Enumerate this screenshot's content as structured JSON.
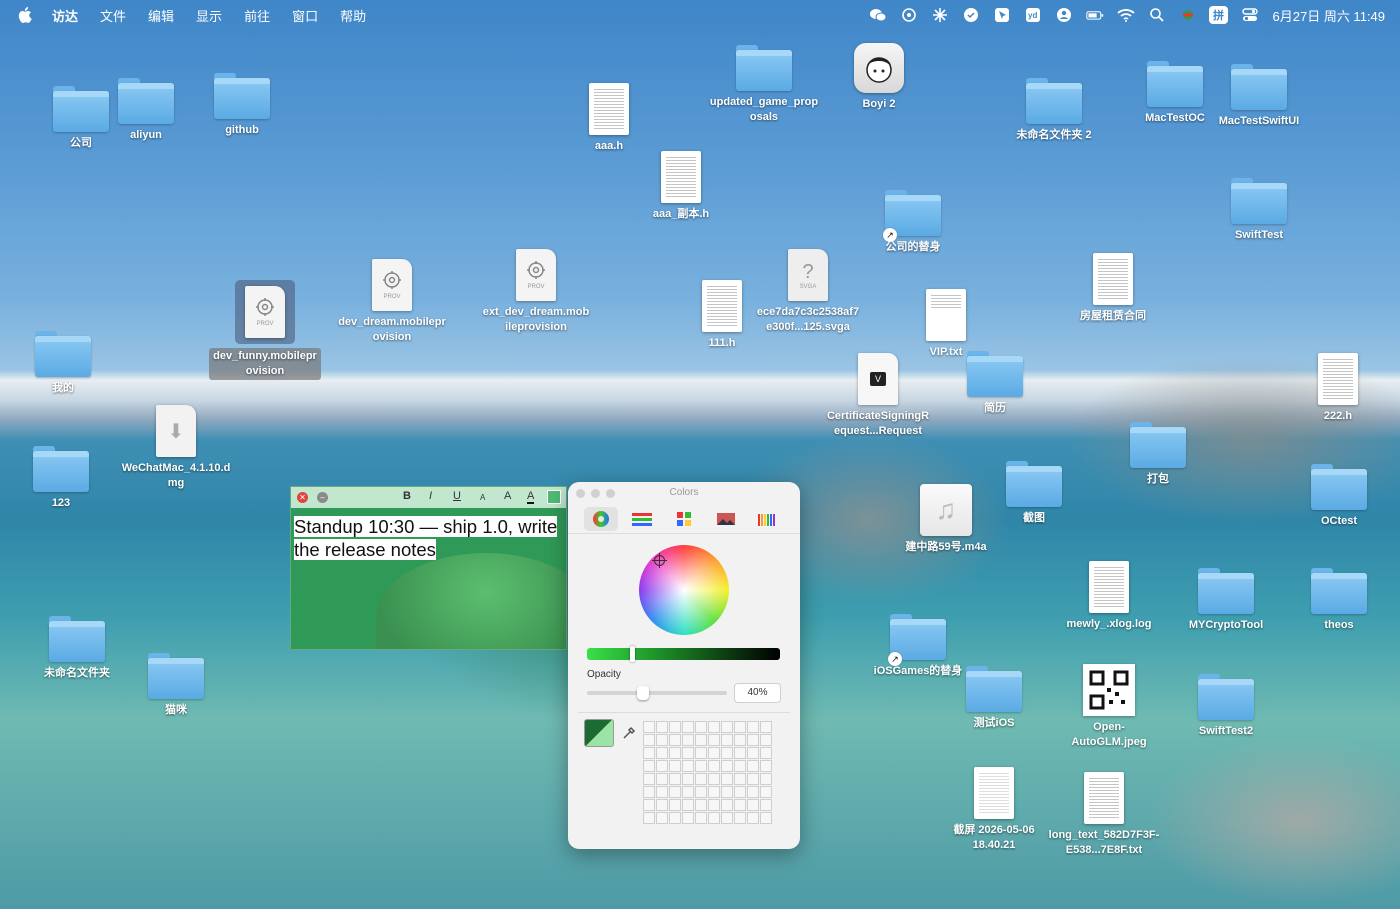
{
  "menubar": {
    "app_name": "访达",
    "menus": [
      "文件",
      "编辑",
      "显示",
      "前往",
      "窗口",
      "帮助"
    ],
    "ime": "拼",
    "clock": "6月27日 周六 11:49"
  },
  "desktop": {
    "items": [
      {
        "label": "公司"
      },
      {
        "label": "aliyun"
      },
      {
        "label": "github"
      },
      {
        "label": "aaa.h"
      },
      {
        "label": "updated_game_proposals"
      },
      {
        "label": "Boyi 2"
      },
      {
        "label": "未命名文件夹 2"
      },
      {
        "label": "MacTestOC"
      },
      {
        "label": "MacTestSwiftUI"
      },
      {
        "label": "aaa_副本.h"
      },
      {
        "label": "公司的替身"
      },
      {
        "label": "SwiftTest"
      },
      {
        "label": "dev_funny.mobileprovision"
      },
      {
        "label": "dev_dream.mobileprovision"
      },
      {
        "label": "ext_dev_dream.mobileprovision"
      },
      {
        "label": "111.h"
      },
      {
        "label": "ece7da7c3c2538af7e300f...125.svga"
      },
      {
        "label": "VIP.txt"
      },
      {
        "label": "房屋租赁合同"
      },
      {
        "label": "我的"
      },
      {
        "label": "CertificateSigningRequest...Request"
      },
      {
        "label": "简历"
      },
      {
        "label": "222.h"
      },
      {
        "label": "WeChatMac_4.1.10.dmg"
      },
      {
        "label": "打包"
      },
      {
        "label": "123"
      },
      {
        "label": "截图"
      },
      {
        "label": "建中路59号.m4a"
      },
      {
        "label": "OCtest"
      },
      {
        "label": "mewly_.xlog.log"
      },
      {
        "label": "MYCryptoTool"
      },
      {
        "label": "theos"
      },
      {
        "label": "未命名文件夹"
      },
      {
        "label": "iOSGames的替身"
      },
      {
        "label": "猫咪"
      },
      {
        "label": "测试iOS"
      },
      {
        "label": "Open-AutoGLM.jpeg"
      },
      {
        "label": "SwiftTest2"
      },
      {
        "label": "截屏 2026-05-06 18.40.21"
      },
      {
        "label": "long_text_582D7F3F-E538...7E8F.txt"
      }
    ]
  },
  "sticky": {
    "format_buttons": [
      "B",
      "I",
      "U",
      "A",
      "A",
      "A"
    ],
    "text": "Standup 10:30 — ship 1.0, write the release notes",
    "color": "#4fbb76"
  },
  "colors_panel": {
    "title": "Colors",
    "opacity_label": "Opacity",
    "opacity_value": "40%",
    "opacity": 0.4
  }
}
